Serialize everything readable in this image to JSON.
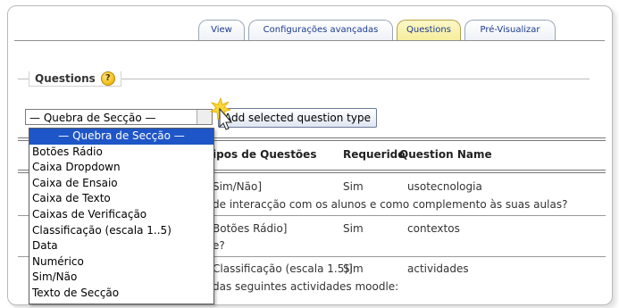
{
  "tabs": [
    {
      "label": "View"
    },
    {
      "label": "Configurações avançadas"
    },
    {
      "label": "Questions",
      "active": true
    },
    {
      "label": "Pré-Visualizar"
    }
  ],
  "section": {
    "legend": "Questions",
    "help_glyph": "?"
  },
  "select": {
    "value": "— Quebra de Secção —",
    "options": [
      "— Quebra de Secção —",
      "Botões Rádio",
      "Caixa Dropdown",
      "Caixa de Ensaio",
      "Caixa de Texto",
      "Caixas de Verificação",
      "Classificação (escala 1..5)",
      "Data",
      "Numérico",
      "Sim/Não",
      "Texto de Secção"
    ]
  },
  "add_button": {
    "label": "Add selected question type"
  },
  "table": {
    "headers": {
      "type": "ipos de Questões",
      "required": "Requerido",
      "name": "Question Name"
    },
    "rows": [
      {
        "type": "Sim/Não]",
        "required": "Sim",
        "name": "usotecnologia",
        "text": "de interacção com os alunos e como complemento às suas aulas?"
      },
      {
        "type": "Botões Rádio]",
        "required": "Sim",
        "name": "contextos",
        "text": "e?"
      },
      {
        "type": "Classificação (escala 1.5)]",
        "required": "Sim",
        "name": "actividades",
        "text": "das seguintes actividades moodle:"
      }
    ]
  },
  "colors": {
    "accent": "#1f56c7",
    "tab_active": "#f6ee9c",
    "tab_text": "#1b3a8f"
  }
}
